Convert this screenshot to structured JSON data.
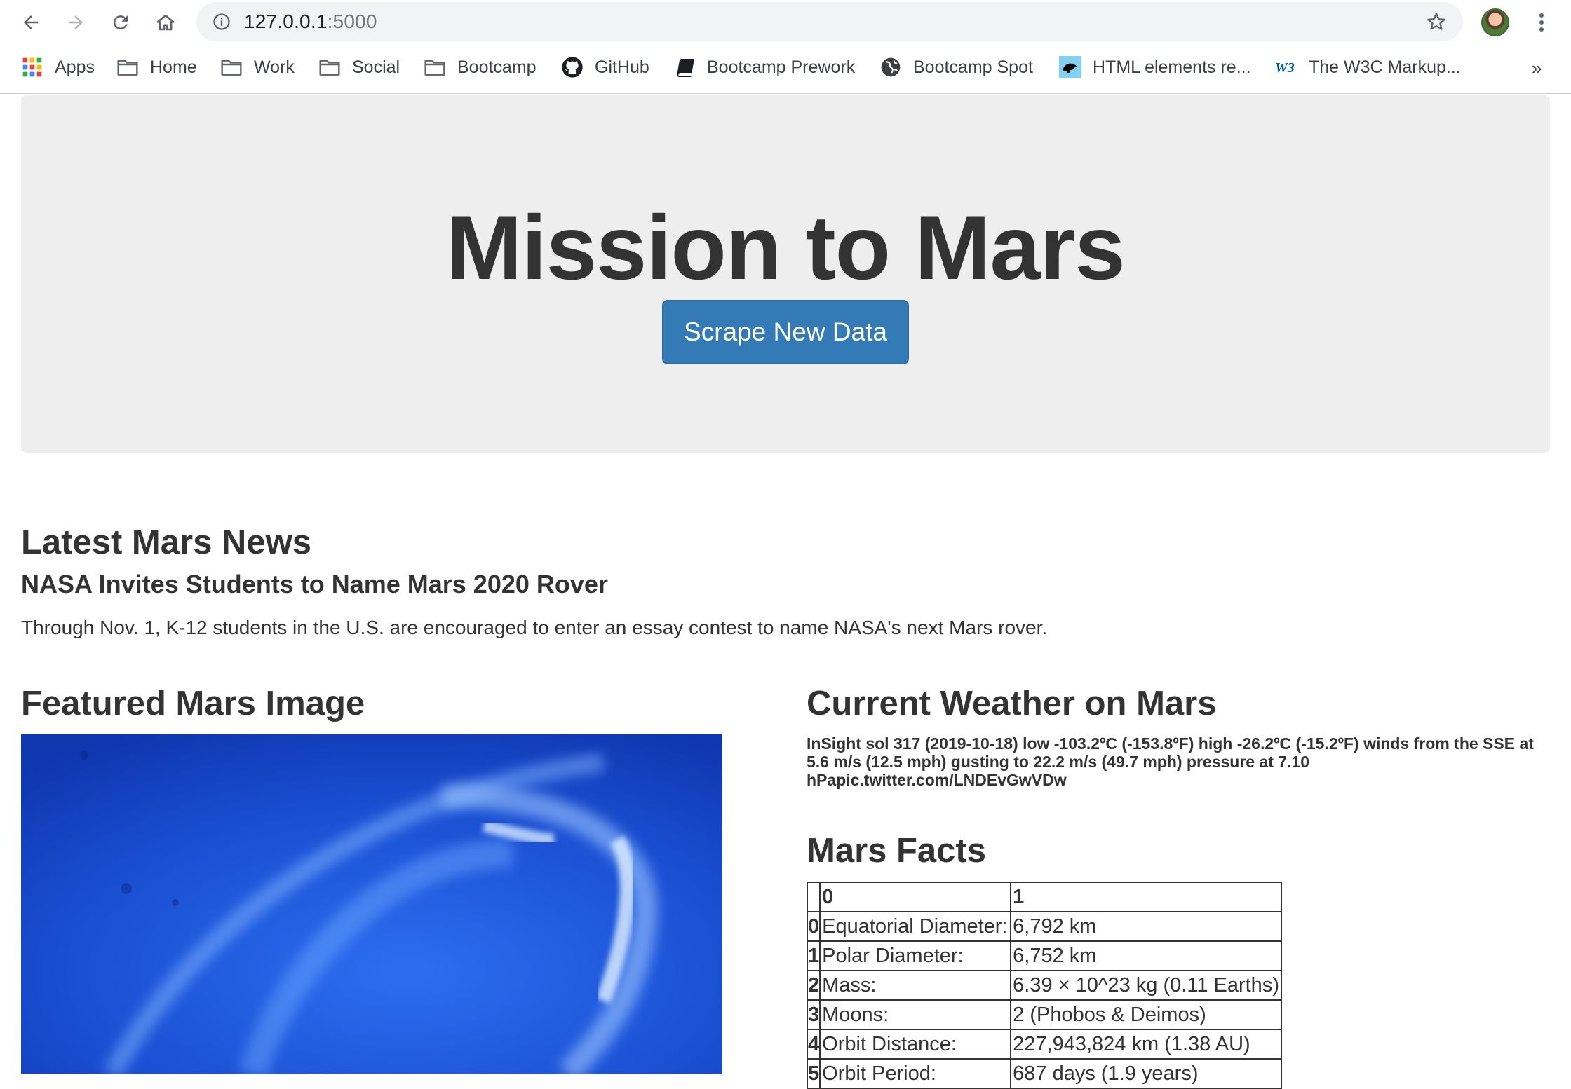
{
  "browser": {
    "url_host": "127.0.0.1",
    "url_port": ":5000",
    "bookmarks": [
      {
        "label": "Apps",
        "icon": "apps-grid-icon"
      },
      {
        "label": "Home",
        "icon": "folder-icon"
      },
      {
        "label": "Work",
        "icon": "folder-icon"
      },
      {
        "label": "Social",
        "icon": "folder-icon"
      },
      {
        "label": "Bootcamp",
        "icon": "folder-icon"
      },
      {
        "label": "GitHub",
        "icon": "github-icon"
      },
      {
        "label": "Bootcamp Prework",
        "icon": "book-icon"
      },
      {
        "label": "Bootcamp Spot",
        "icon": "globe-icon"
      },
      {
        "label": "HTML elements re...",
        "icon": "mdn-icon"
      },
      {
        "label": "The W3C Markup...",
        "icon": "w3c-icon"
      }
    ],
    "overflow": "»"
  },
  "hero": {
    "title": "Mission to Mars",
    "button_label": "Scrape New Data",
    "button_color": "#337ab7",
    "background": "#eeeeee"
  },
  "news": {
    "heading": "Latest Mars News",
    "title": "NASA Invites Students to Name Mars 2020 Rover",
    "body": "Through Nov. 1, K-12 students in the U.S. are encouraged to enter an essay contest to name NASA's next Mars rover."
  },
  "featured": {
    "heading": "Featured Mars Image"
  },
  "weather": {
    "heading": "Current Weather on Mars",
    "text": "InSight sol 317 (2019-10-18) low -103.2ºC (-153.8ºF) high -26.2ºC (-15.2ºF) winds from the SSE at 5.6 m/s (12.5 mph) gusting to 22.2 m/s (49.7 mph) pressure at 7.10 hPapic.twitter.com/LNDEvGwVDw"
  },
  "facts": {
    "heading": "Mars Facts",
    "columns": [
      "",
      "0",
      "1"
    ],
    "rows": [
      [
        "0",
        "Equatorial Diameter:",
        "6,792 km"
      ],
      [
        "1",
        "Polar Diameter:",
        "6,752 km"
      ],
      [
        "2",
        "Mass:",
        "6.39 × 10^23 kg (0.11 Earths)"
      ],
      [
        "3",
        "Moons:",
        "2 (Phobos & Deimos)"
      ],
      [
        "4",
        "Orbit Distance:",
        "227,943,824 km (1.38 AU)"
      ],
      [
        "5",
        "Orbit Period:",
        "687 days (1.9 years)"
      ]
    ]
  }
}
